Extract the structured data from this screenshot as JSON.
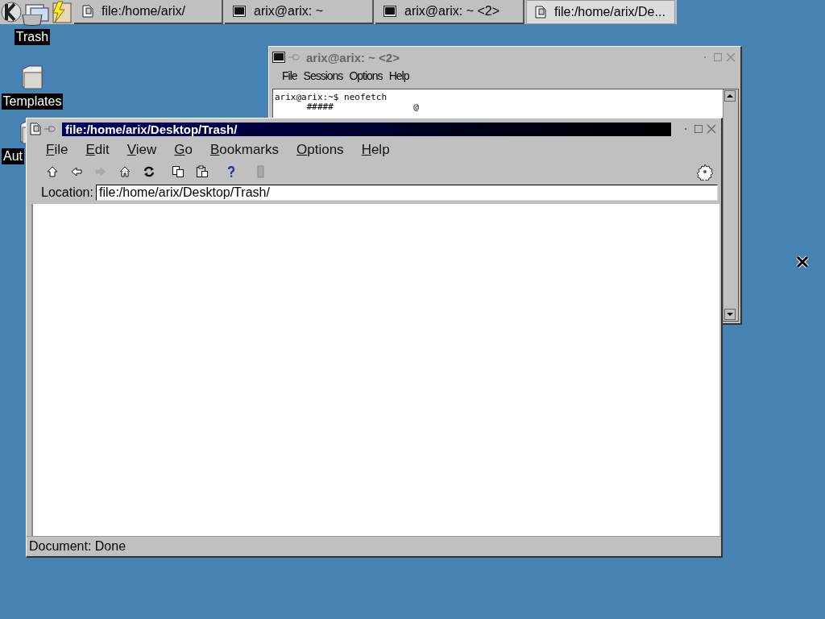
{
  "taskbar": {
    "tasks": [
      {
        "label": "file:/home/arix/",
        "kind": "file",
        "selected": false
      },
      {
        "label": "arix@arix: ~",
        "kind": "terminal",
        "selected": false
      },
      {
        "label": "arix@arix: ~ <2>",
        "kind": "terminal",
        "selected": false
      },
      {
        "label": "file:/home/arix/De...",
        "kind": "file",
        "selected": true
      }
    ]
  },
  "desktop_icons": [
    {
      "label": "Trash",
      "kind": "trash"
    },
    {
      "label": "Templates",
      "kind": "folder"
    },
    {
      "label": "Aut",
      "kind": "folder"
    }
  ],
  "terminal_window": {
    "title": "arix@arix: ~ <2>",
    "active": false,
    "menu": [
      "File",
      "Sessions",
      "Options",
      "Help"
    ],
    "lines": [
      "arix@arix:~$ neofetch",
      "      #####               @"
    ]
  },
  "browser_window": {
    "title": "file:/home/arix/Desktop/Trash/",
    "active": true,
    "menu": [
      "File",
      "Edit",
      "View",
      "Go",
      "Bookmarks",
      "Options",
      "Help"
    ],
    "toolbar": [
      {
        "kind": "up",
        "disabled": false
      },
      {
        "kind": "back",
        "disabled": false
      },
      {
        "kind": "forward",
        "disabled": true
      },
      {
        "kind": "home",
        "disabled": false
      },
      {
        "kind": "reload",
        "disabled": false
      },
      {
        "kind": "copy",
        "disabled": false
      },
      {
        "kind": "paste",
        "disabled": false
      },
      {
        "kind": "help",
        "disabled": false
      },
      {
        "kind": "stop",
        "disabled": true
      }
    ],
    "location": {
      "label": "Location:",
      "value": "file:/home/arix/Desktop/Trash/"
    },
    "status": "Document: Done"
  }
}
